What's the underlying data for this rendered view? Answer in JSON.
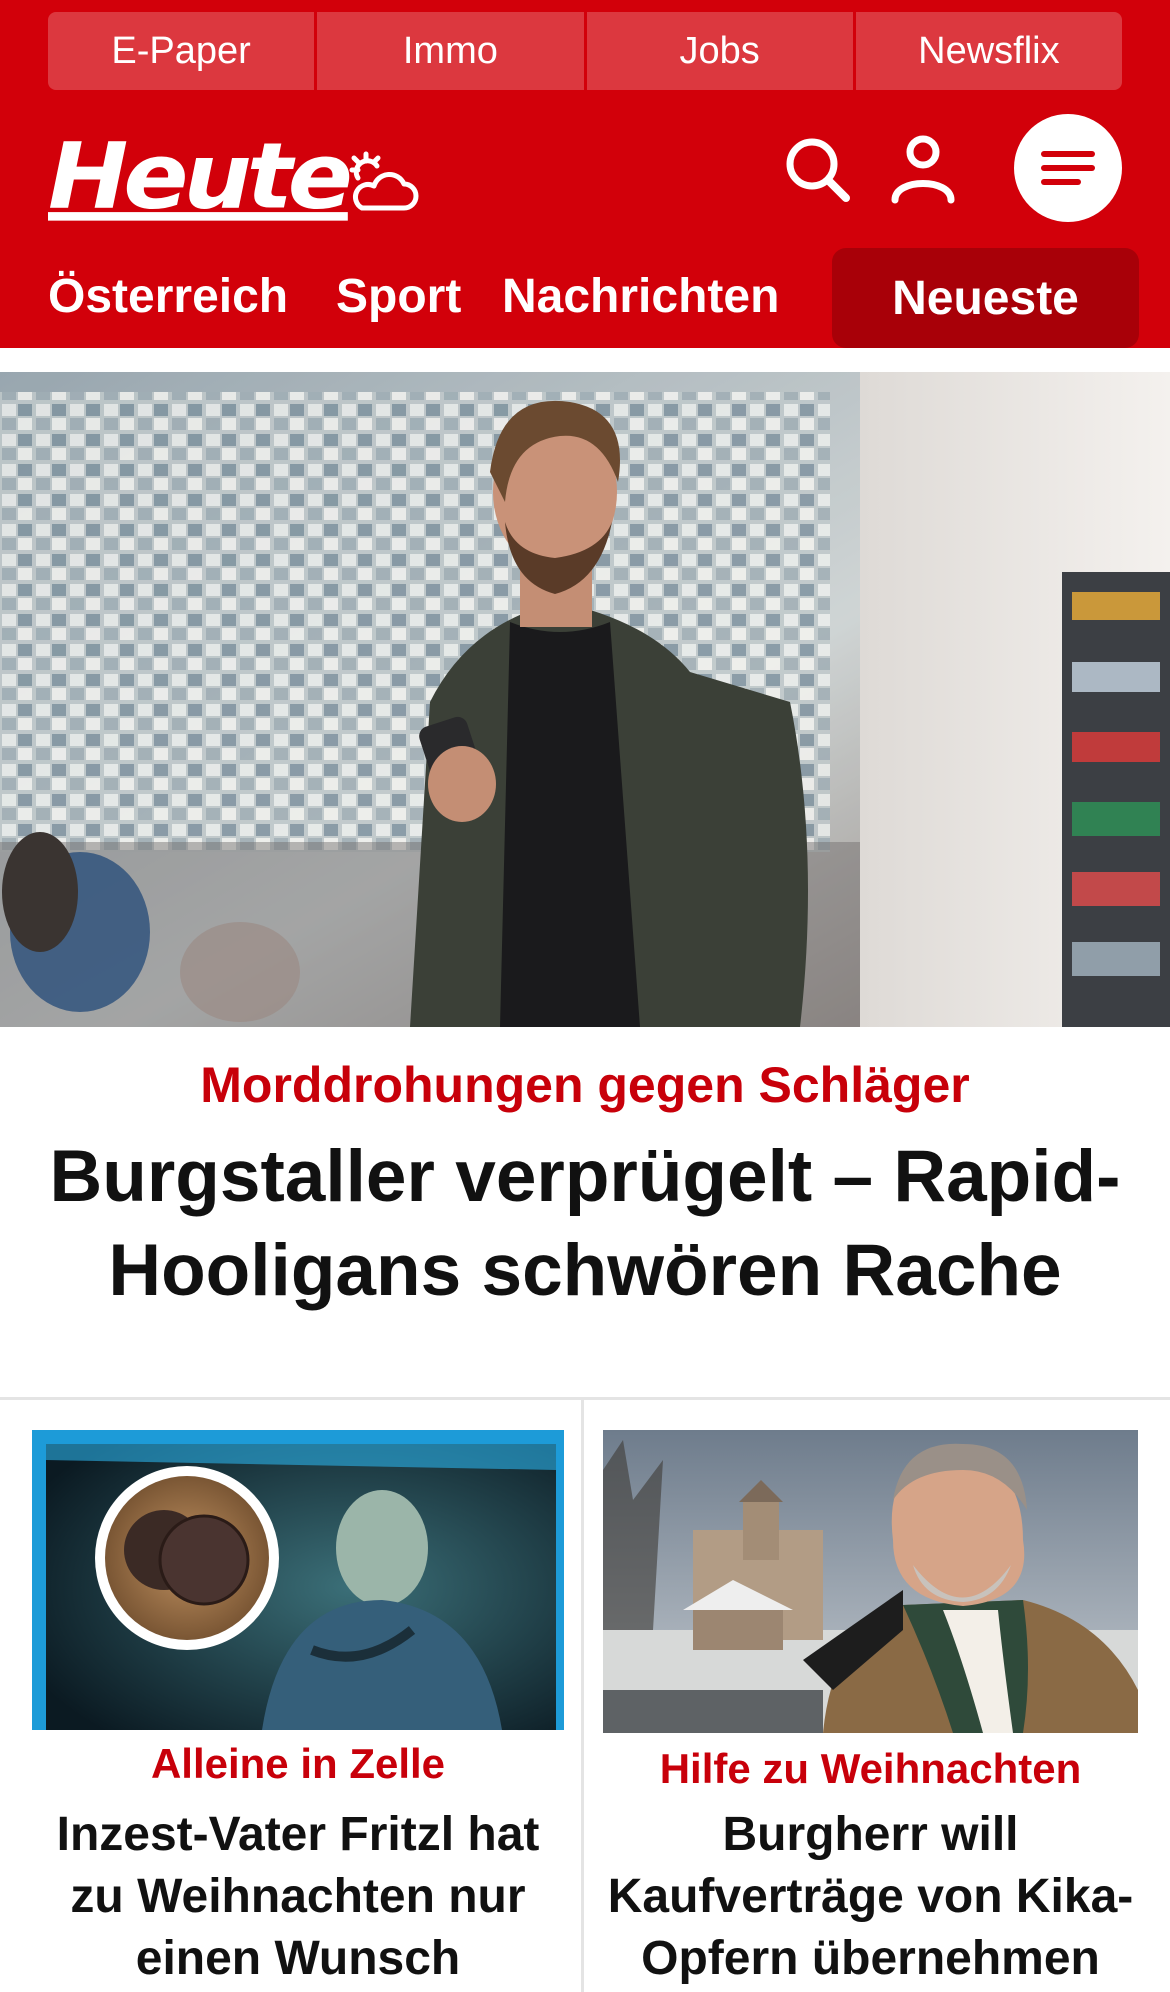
{
  "service_bar": {
    "items": [
      "E-Paper",
      "Immo",
      "Jobs",
      "Newsflix"
    ]
  },
  "brand": {
    "logo_text": "Heute",
    "primary_color": "#d2000a",
    "dark_red": "#a80008"
  },
  "header_icons": [
    "weather-partly-cloudy-icon",
    "search-icon",
    "user-icon",
    "menu-icon"
  ],
  "section_nav": {
    "items": [
      "Österreich",
      "Sport",
      "Nachrichten"
    ],
    "highlight": "Neueste"
  },
  "hero": {
    "kicker": "Morddrohungen gegen Schläger",
    "title": "Burgstaller verprügelt – Rapid-Hooligans schwören Rache"
  },
  "teasers": [
    {
      "kicker": "Alleine in Zelle",
      "title": "Inzest-Vater Fritzl hat zu Weihnachten nur einen Wunsch"
    },
    {
      "kicker": "Hilfe zu Weihnachten",
      "title": "Burgherr will Kaufverträge von Kika-Opfern übernehmen"
    }
  ]
}
